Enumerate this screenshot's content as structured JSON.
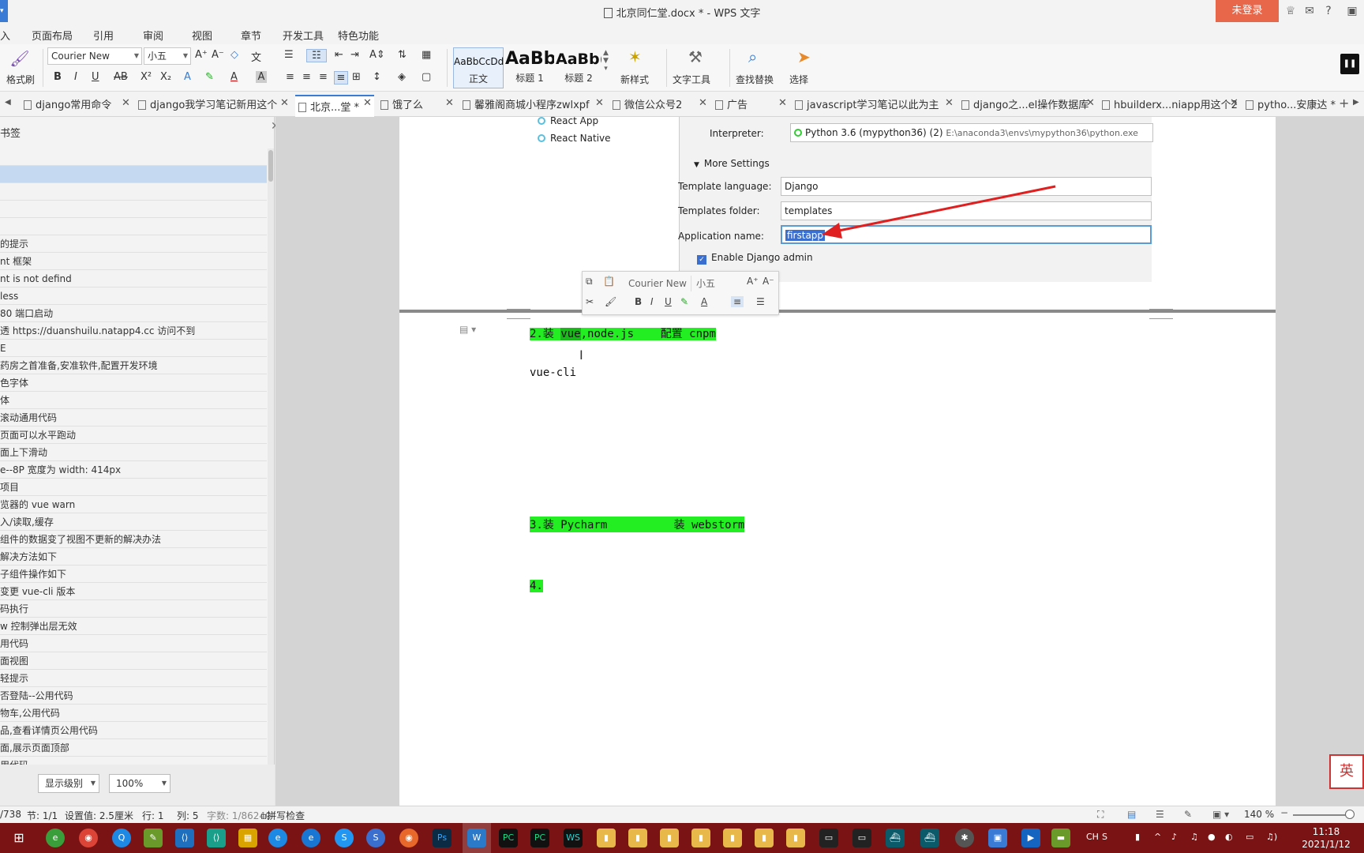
{
  "window": {
    "title": "北京同仁堂.docx * - WPS 文字",
    "login_label": "未登录",
    "left_mark": "▾"
  },
  "menu": [
    "入",
    "页面布局",
    "引用",
    "审阅",
    "视图",
    "章节",
    "开发工具",
    "特色功能"
  ],
  "ribbon": {
    "format_painter": "格式刷",
    "font_name": "Courier New",
    "font_size": "小五",
    "styles": [
      {
        "sample": "AaBbCcDd",
        "name": "正文"
      },
      {
        "sample": "AaBb",
        "name": "标题 1"
      },
      {
        "sample": "AaBb(",
        "name": "标题 2"
      }
    ],
    "new_style": "新样式",
    "text_tools": "文字工具",
    "find_replace": "查找替换",
    "select": "选择"
  },
  "tabs": [
    {
      "label": "django常用命令",
      "active": false
    },
    {
      "label": "django我学习笔记新用这个",
      "active": false
    },
    {
      "label": "北京...堂 *",
      "active": true
    },
    {
      "label": "饿了么",
      "active": false
    },
    {
      "label": "馨雅阁商城小程序zwlxpf",
      "active": false
    },
    {
      "label": "微信公众号2",
      "active": false
    },
    {
      "label": "广告",
      "active": false
    },
    {
      "label": "javascript学习笔记以此为主",
      "active": false
    },
    {
      "label": "django之...el操作数据库",
      "active": false
    },
    {
      "label": "hbuilderx...niapp用这个2",
      "active": false
    },
    {
      "label": "pytho...安康达 *",
      "active": false
    }
  ],
  "sidebar": {
    "title": "书签",
    "items": [
      "",
      "",
      "",
      "",
      "",
      "的提示",
      "nt 框架",
      "nt is not defind",
      " less",
      " 80 端口启动",
      "透 https://duanshuilu.natapp4.cc 访问不到",
      "E",
      "药房之首准备,安准软件,配置开发环境",
      "色字体",
      "体",
      "滚动通用代码",
      "页面可以水平跑动",
      "面上下滑动",
      "e--8P 宽度为 width: 414px",
      "项目",
      "览器的 vue warn",
      "入/读取,缓存",
      "组件的数据变了视图不更新的解决办法",
      "解决方法如下",
      "子组件操作如下",
      "变更 vue-cli 版本",
      "码执行",
      "w 控制弹出层无效",
      "用代码",
      "面视图",
      " 轻提示",
      "否登陆--公用代码",
      "物车,公用代码",
      "品,查看详情页公用代码",
      "面,展示页面顶部",
      "用代码"
    ],
    "level_select": "显示级别",
    "zoom_select": "100%"
  },
  "embedded_screenshot": {
    "projects": [
      "React App",
      "React Native"
    ],
    "interpreter_label": "Interpreter:",
    "interpreter_value": "Python 3.6 (mypython36) (2)",
    "interpreter_path": "E:\\anaconda3\\envs\\mypython36\\python.exe",
    "more_settings": "More Settings",
    "template_language_label": "Template language:",
    "template_language_value": "Django",
    "templates_folder_label": "Templates folder:",
    "templates_folder_value": "templates",
    "app_name_label": "Application name:",
    "app_name_value": "firstapp",
    "enable_admin": "Enable Django admin"
  },
  "mini_toolbar": {
    "font_name": "Courier New",
    "font_size": "小五"
  },
  "document": {
    "line1_a": "2.装 ",
    "line1_sel": "vue",
    "line1_b": ",node.js    配置 cnpm",
    "line2": "vue-cli",
    "line3": "3.装 Pycharm          装 webstorm",
    "line4": "4."
  },
  "statusbar": {
    "page": "/738",
    "section": "节: 1/1",
    "setting": "设置值: 2.5厘米",
    "row": "行: 1",
    "col": "列: 5",
    "words": "字数: 1/86240",
    "spell": "拼写检查",
    "zoom": "140 %"
  },
  "taskbar": {
    "time": "11:18",
    "date": "2021/1/12",
    "ime": "CH"
  },
  "colors": {
    "highlight": "#22ee22",
    "accent": "#3a7bd5",
    "login": "#e8674b",
    "taskbar": "#7a1414"
  }
}
